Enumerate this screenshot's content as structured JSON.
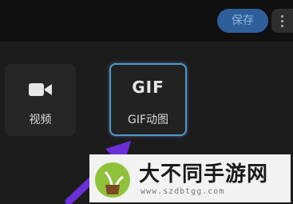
{
  "header": {
    "save_label": "保存"
  },
  "export_options": [
    {
      "label": "视频",
      "icon": "video-camera-icon"
    },
    {
      "label": "GIF动图",
      "icon": "gif-icon",
      "icon_text": "GIF",
      "selected": true
    }
  ],
  "watermark": {
    "title": "大不同手游网",
    "url": "www.szdbtgg.com"
  },
  "colors": {
    "accent_border": "#4f9ac8",
    "arrow": "#6a2fd6",
    "save_button_bg": "#2f5f9a"
  }
}
